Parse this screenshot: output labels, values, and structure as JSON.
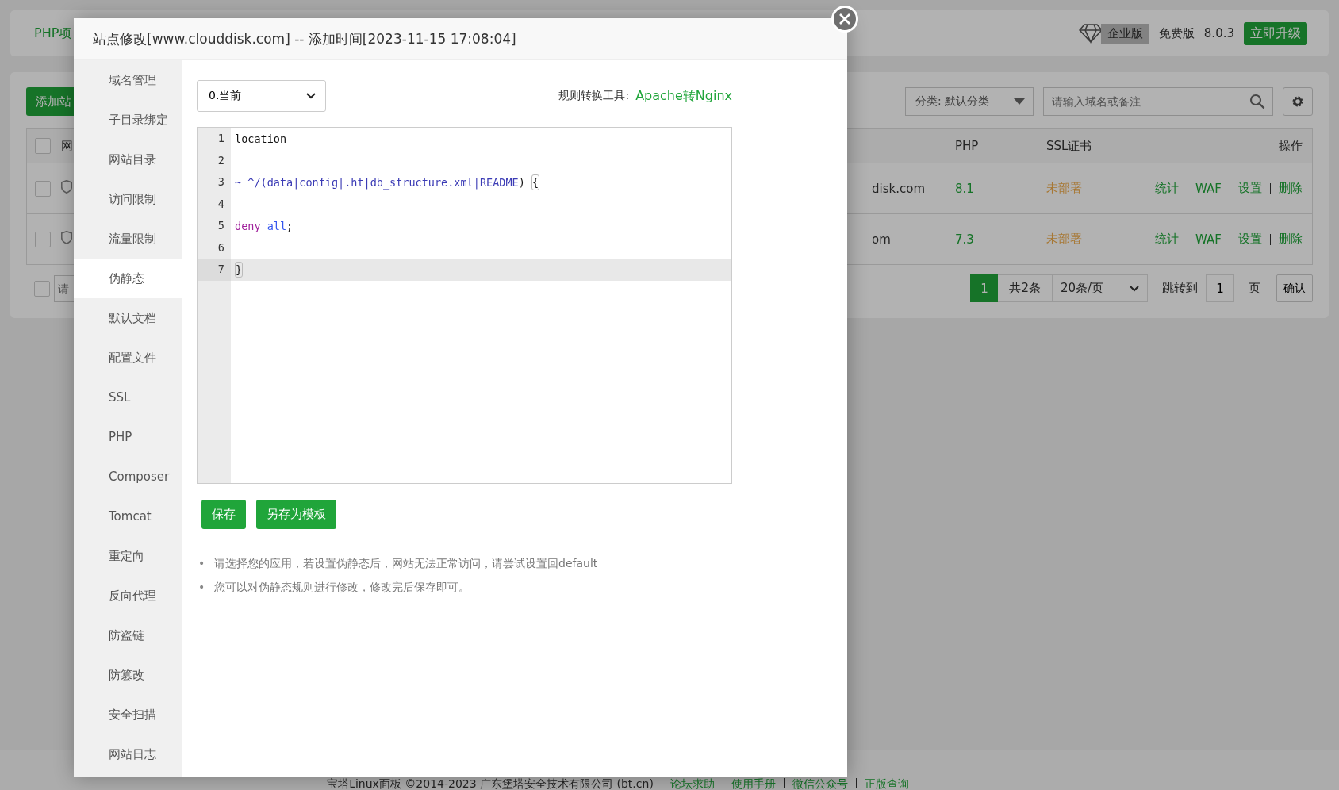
{
  "page": {
    "tab": "PHP项",
    "edition_badge": "企业版",
    "edition": "免费版",
    "version": "8.0.3",
    "upgrade_button": "立即升级",
    "add_button": "添加站",
    "category_select": "分类: 默认分类",
    "search": {
      "placeholder": "请输入域名或备注"
    },
    "table": {
      "all_checked": false,
      "columns": [
        "网",
        "PHP",
        "SSL证书",
        "操作"
      ],
      "rows": [
        {
          "checked": false,
          "domain": "disk.com",
          "php": "8.1",
          "ssl": "未部署",
          "actions": [
            "统计",
            "WAF",
            "设置",
            "删除"
          ]
        },
        {
          "checked": false,
          "domain": "om",
          "php": "7.3",
          "ssl": "未部署",
          "actions": [
            "统计",
            "WAF",
            "设置",
            "删除"
          ]
        }
      ]
    },
    "batch_field": {
      "checked": false,
      "placeholder": "请"
    },
    "pagination": {
      "pages": [
        {
          "label": "1",
          "selected": true
        }
      ],
      "total": "共2条",
      "per_page": "20条/页",
      "jump_label": "跳转到",
      "jump_value": "1",
      "page_unit": "页",
      "confirm": "确认"
    }
  },
  "footer": {
    "copyright": "宝塔Linux面板 ©2014-2023 广东堡塔安全技术有限公司 (bt.cn)",
    "links": [
      "论坛求助",
      "使用手册",
      "微信公众号",
      "正版查询"
    ]
  },
  "dialog": {
    "title": "站点修改[www.clouddisk.com] -- 添加时间[2023-11-15 17:08:04]",
    "sidebar": [
      {
        "label": "域名管理",
        "selected": false
      },
      {
        "label": "子目录绑定",
        "selected": false
      },
      {
        "label": "网站目录",
        "selected": false
      },
      {
        "label": "访问限制",
        "selected": false
      },
      {
        "label": "流量限制",
        "selected": false
      },
      {
        "label": "伪静态",
        "selected": true
      },
      {
        "label": "默认文档",
        "selected": false
      },
      {
        "label": "配置文件",
        "selected": false
      },
      {
        "label": "SSL",
        "selected": false
      },
      {
        "label": "PHP",
        "selected": false
      },
      {
        "label": "Composer",
        "selected": false
      },
      {
        "label": "Tomcat",
        "selected": false
      },
      {
        "label": "重定向",
        "selected": false
      },
      {
        "label": "反向代理",
        "selected": false
      },
      {
        "label": "防盗链",
        "selected": false
      },
      {
        "label": "防篡改",
        "selected": false
      },
      {
        "label": "安全扫描",
        "selected": false
      },
      {
        "label": "网站日志",
        "selected": false
      }
    ],
    "template_select": "0.当前",
    "converter_label": "规则转换工具:",
    "converter_link": "Apache转Nginx",
    "code": [
      {
        "number": "1",
        "active": false,
        "words": [
          [
            {
              "kind": "plain",
              "text": "location"
            }
          ]
        ]
      },
      {
        "number": "2",
        "active": false
      },
      {
        "number": "3",
        "active": false,
        "words": [
          [
            {
              "kind": "regex",
              "text": "~"
            }
          ],
          [
            {
              "kind": "regex",
              "text": "^/(data|config|.ht|db_structure.xml|README"
            },
            {
              "kind": "plain",
              "text": ")"
            }
          ],
          [
            {
              "kind": "bracket",
              "text": "{"
            }
          ]
        ]
      },
      {
        "number": "4",
        "active": false
      },
      {
        "number": "5",
        "active": false,
        "words": [
          [
            {
              "kind": "keyword",
              "text": "deny"
            }
          ],
          [
            {
              "kind": "atom",
              "text": "all"
            },
            {
              "kind": "plain",
              "text": ";"
            }
          ]
        ]
      },
      {
        "number": "6",
        "active": false
      },
      {
        "number": "7",
        "active": true,
        "words": [
          [
            {
              "kind": "bracket",
              "text": "}"
            }
          ]
        ]
      }
    ],
    "buttons": [
      "保存",
      "另存为模板"
    ],
    "notes": [
      {
        "bullet": "•",
        "text": "请选择您的应用，若设置伪静态后，网站无法正常访问，请尝试设置回default"
      },
      {
        "bullet": "•",
        "text": "您可以对伪静态规则进行修改，修改完后保存即可。"
      }
    ]
  }
}
